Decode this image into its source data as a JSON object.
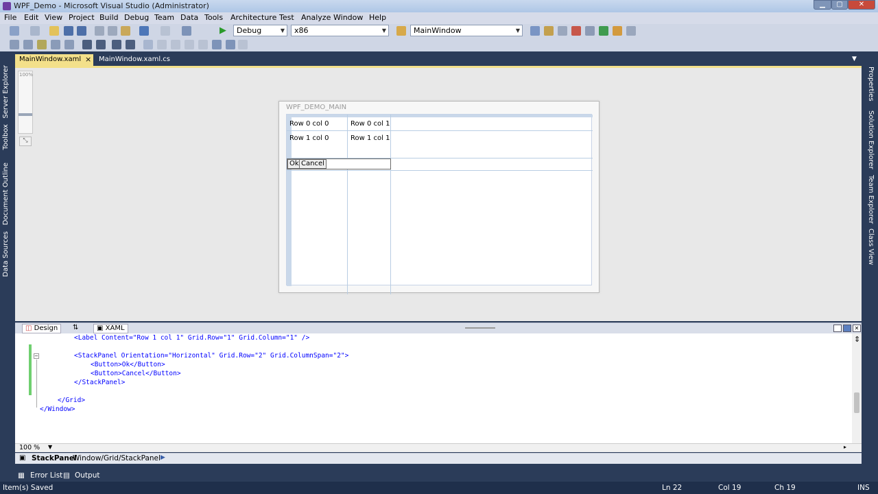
{
  "window": {
    "title": "WPF_Demo - Microsoft Visual Studio (Administrator)"
  },
  "menu": [
    "File",
    "Edit",
    "View",
    "Project",
    "Build",
    "Debug",
    "Team",
    "Data",
    "Tools",
    "Architecture",
    "Test",
    "Analyze",
    "Window",
    "Help"
  ],
  "toolbar": {
    "config": "Debug",
    "platform": "x86",
    "find": "MainWindow"
  },
  "sidebar_left": [
    "Server Explorer",
    "Toolbox",
    "Document Outline",
    "Data Sources"
  ],
  "sidebar_right": [
    "Properties",
    "Solution Explorer",
    "Team Explorer",
    "Class View"
  ],
  "doc_tabs": [
    {
      "label": "MainWindow.xaml",
      "active": true,
      "close": "×"
    },
    {
      "label": "MainWindow.xaml.cs",
      "active": false
    }
  ],
  "designer": {
    "zoom_top": "100%",
    "window_title": "WPF_DEMO_MAIN",
    "cells": [
      "Row 0 col 0",
      "Row 0 col 1",
      "Row 1 col 0",
      "Row 1 col 1"
    ],
    "ok_button": "Ok",
    "cancel_button": "Cancel"
  },
  "split": {
    "design": "Design",
    "swap": "⇅",
    "xaml": "XAML"
  },
  "code_lines": [
    "<Label Content=\"Row 1 col 1\" Grid.Row=\"1\" Grid.Column=\"1\" />",
    "",
    "<StackPanel Orientation=\"Horizontal\" Grid.Row=\"2\" Grid.ColumnSpan=\"2\">",
    "<Button>Ok</Button>",
    "<Button>Cancel</Button>",
    "</StackPanel>",
    "",
    "</Grid>",
    "</Window>"
  ],
  "editor_zoom": "100 %",
  "breadcrumb": {
    "current": "StackPanel",
    "path": "Window/Grid/StackPanel"
  },
  "bottom_tabs": [
    "Error List",
    "Output"
  ],
  "status": {
    "message": "Item(s) Saved",
    "ln": "Ln 22",
    "col": "Col 19",
    "ch": "Ch 19",
    "mode": "INS"
  },
  "colors": {
    "chrome_dark": "#2b3c59",
    "toolbar": "#cfd6e5",
    "designer_bg": "#e8e8e8",
    "active_tab": "#f3e08a",
    "changed_line": "#6fcf6f"
  }
}
